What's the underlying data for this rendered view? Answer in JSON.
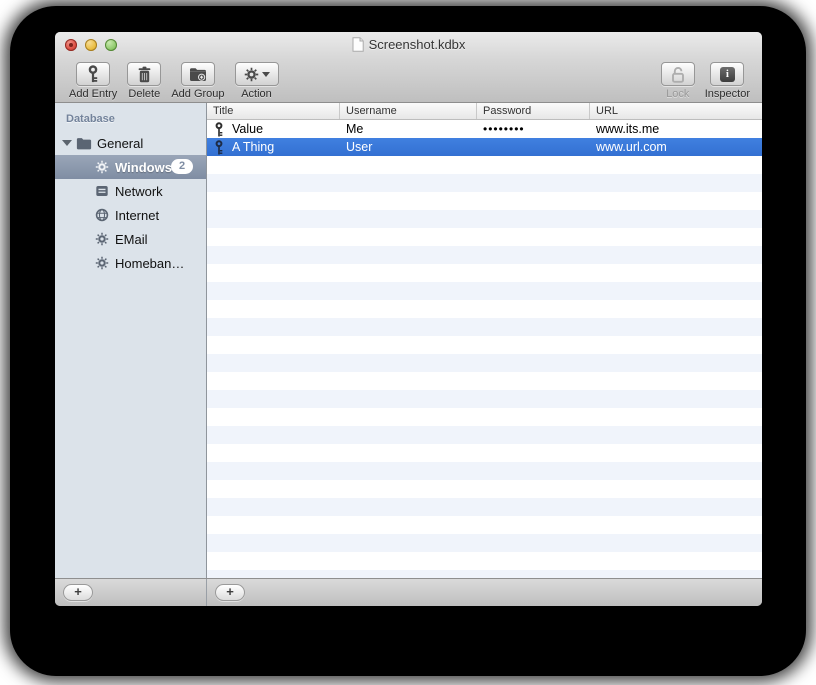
{
  "window_title": "Screenshot.kdbx",
  "toolbar": {
    "add_entry": "Add Entry",
    "delete_label": "Delete",
    "add_group": "Add Group",
    "action": "Action",
    "lock": "Lock",
    "inspector": "Inspector",
    "inspector_glyph": "i"
  },
  "sidebar": {
    "header": "Database",
    "items": [
      {
        "label": "General",
        "icon": "folder-icon",
        "expanded": true
      },
      {
        "label": "Windows",
        "icon": "gear-icon",
        "badge": "2",
        "selected": true
      },
      {
        "label": "Network",
        "icon": "server-icon"
      },
      {
        "label": "Internet",
        "icon": "globe-icon"
      },
      {
        "label": "EMail",
        "icon": "gear-icon"
      },
      {
        "label": "Homeban…",
        "icon": "gear-icon"
      }
    ],
    "add_button": "+"
  },
  "table": {
    "columns": [
      "Title",
      "Username",
      "Password",
      "URL"
    ],
    "rows": [
      {
        "title": "Value",
        "username": "Me",
        "password": "••••••••",
        "url": "www.its.me",
        "icon": "key-icon"
      },
      {
        "title": "A Thing",
        "username": "User",
        "password": "",
        "url": "www.url.com",
        "icon": "key-icon",
        "selected": true
      }
    ],
    "add_button": "+"
  },
  "colors": {
    "selection_blue": "#3875d6",
    "sidebar_selection": "#8997ac",
    "row_stripe": "#f0f4fb",
    "sidebar_bg": "#dce3ea"
  }
}
